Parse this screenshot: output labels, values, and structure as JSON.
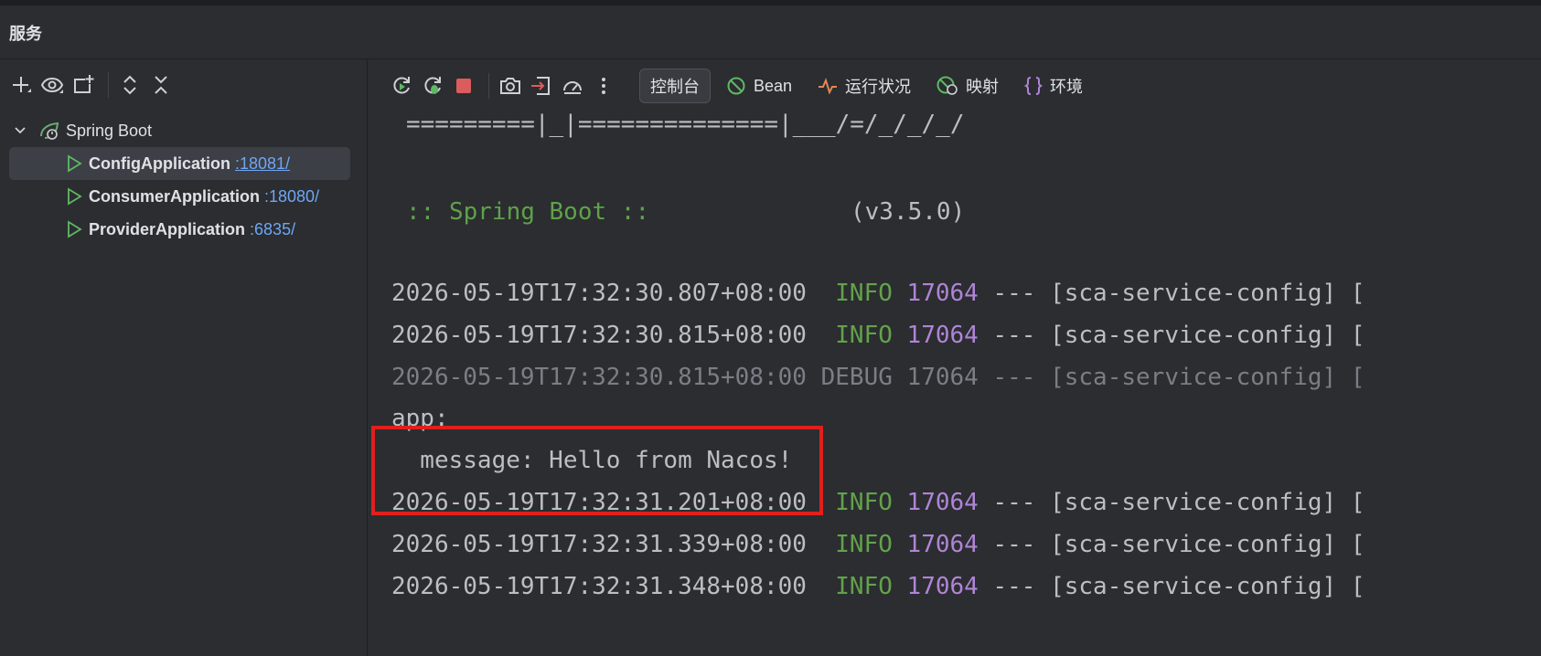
{
  "panel_title": "服务",
  "tree": {
    "root_label": "Spring Boot",
    "apps": [
      {
        "name": "ConfigApplication",
        "port": ":18081/"
      },
      {
        "name": "ConsumerApplication",
        "port": ":18080/"
      },
      {
        "name": "ProviderApplication",
        "port": ":6835/"
      }
    ]
  },
  "tabs": {
    "console": "控制台",
    "bean": "Bean",
    "health": "运行状况",
    "mappings": "映射",
    "env": "环境"
  },
  "console": {
    "banner_line": "=========|_|==============|___/=/_/_/_/",
    "spring_label": ":: Spring Boot ::",
    "version": "(v3.5.0)",
    "logs": [
      {
        "ts": "2026-05-19T17:32:30.807+08:00",
        "level": " INFO",
        "pid": "17064",
        "rest": " --- [sca-service-config] ["
      },
      {
        "ts": "2026-05-19T17:32:30.815+08:00",
        "level": " INFO",
        "pid": "17064",
        "rest": " --- [sca-service-config] ["
      },
      {
        "ts": "2026-05-19T17:32:30.815+08:00",
        "level": "DEBUG",
        "pid": "17064",
        "rest": " --- [sca-service-config] ["
      },
      {
        "ts": "2026-05-19T17:32:31.201+08:00",
        "level": " INFO",
        "pid": "17064",
        "rest": " --- [sca-service-config] ["
      },
      {
        "ts": "2026-05-19T17:32:31.339+08:00",
        "level": " INFO",
        "pid": "17064",
        "rest": " --- [sca-service-config] ["
      },
      {
        "ts": "2026-05-19T17:32:31.348+08:00",
        "level": " INFO",
        "pid": "17064",
        "rest": " --- [sca-service-config] ["
      }
    ],
    "yaml_key": "app:",
    "yaml_value": "  message: Hello from Nacos!"
  },
  "colors": {
    "background": "#2b2d30",
    "info": "#63a24b",
    "pid": "#b084d6",
    "highlight_border": "#e0201c",
    "port_link": "#6fa6f5"
  }
}
